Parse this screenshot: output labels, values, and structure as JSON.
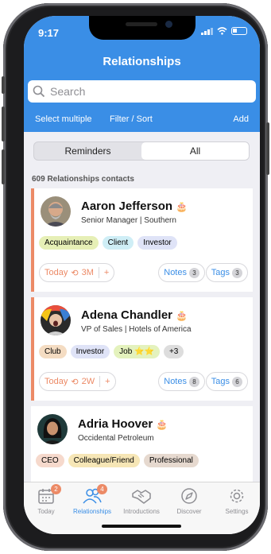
{
  "status": {
    "time": "9:17"
  },
  "header": {
    "title": "Relationships",
    "search_placeholder": "Search",
    "select_multiple": "Select multiple",
    "filter_sort": "Filter / Sort",
    "add": "Add"
  },
  "segments": {
    "reminders": "Reminders",
    "all": "All",
    "selected": "All"
  },
  "count_label": "609 Relationships contacts",
  "contacts": [
    {
      "name": "Aaron Jefferson",
      "subtitle": "Senior Manager | Southern",
      "tags": [
        "Acquaintance",
        "Client",
        "Investor"
      ],
      "reminder": "Today",
      "interval": "3M",
      "notes_label": "Notes",
      "notes_count": "3",
      "tags_label": "Tags",
      "tags_count": "3"
    },
    {
      "name": "Adena Chandler",
      "subtitle": "VP of Sales | Hotels of America",
      "tags": [
        "Club",
        "Investor",
        "Job ⭐⭐",
        "+3"
      ],
      "reminder": "Today",
      "interval": "2W",
      "notes_label": "Notes",
      "notes_count": "8",
      "tags_label": "Tags",
      "tags_count": "6"
    },
    {
      "name": "Adria Hoover",
      "subtitle": "Occidental Petroleum",
      "tags": [
        "CEO",
        "Colleague/Friend",
        "Professional"
      ]
    }
  ],
  "tabbar": {
    "today": {
      "label": "Today",
      "badge": "2"
    },
    "relationships": {
      "label": "Relationships",
      "badge": "4"
    },
    "introductions": {
      "label": "Introductions"
    },
    "discover": {
      "label": "Discover"
    },
    "settings": {
      "label": "Settings"
    }
  },
  "colors": {
    "header_blue": "#3a8ee6",
    "accent_orange": "#ec8a66",
    "tag_acquaintance": "#e6efb6",
    "tag_client": "#cfeef6",
    "tag_investor": "#dfe3f7",
    "tag_club": "#f4dcc2",
    "tag_job": "#e4f2bd",
    "tag_more": "#dddddd",
    "tag_ceo": "#f6d9cc",
    "tag_colleague": "#f6e6b6",
    "tag_professional": "#e6d9cf"
  }
}
